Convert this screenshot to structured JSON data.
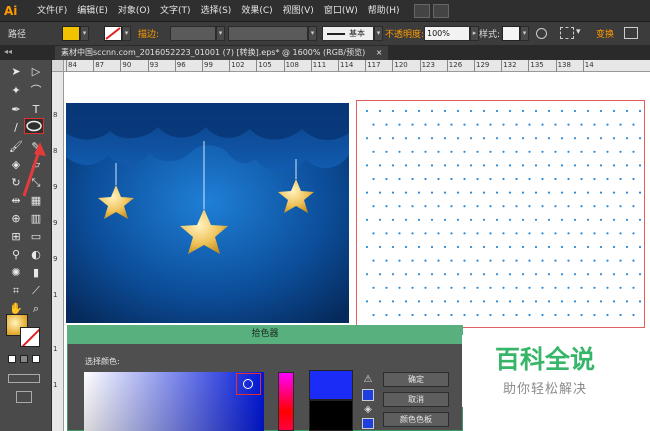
{
  "app": {
    "logo": "Ai"
  },
  "menubar": {
    "items": [
      "文件(F)",
      "编辑(E)",
      "对象(O)",
      "文字(T)",
      "选择(S)",
      "效果(C)",
      "视图(V)",
      "窗口(W)",
      "帮助(H)"
    ]
  },
  "controlbar": {
    "path_label": "路径",
    "stroke_label": "描边:",
    "basic_label": "基本",
    "opacity_label": "不透明度:",
    "opacity_value": "100%",
    "style_label": "样式:",
    "transform_label": "变换",
    "colors": {
      "fill": "#f2c200",
      "warning": "#ff9a00"
    }
  },
  "document": {
    "tab_title": "素材中国sccnn.com_2016052223_01001  (7)  [转换].eps* @ 1600% (RGB/预览)"
  },
  "ruler": {
    "marks": [
      "84",
      "87",
      "90",
      "93",
      "96",
      "99",
      "102",
      "105",
      "108",
      "111",
      "114",
      "117",
      "120",
      "123",
      "126",
      "129",
      "132",
      "135",
      "138",
      "14"
    ]
  },
  "tools": [
    "selection-tool",
    "direct-selection-tool",
    "magic-wand-tool",
    "lasso-tool",
    "pen-tool",
    "type-tool",
    "line-tool",
    "ellipse-tool",
    "paintbrush-tool",
    "pencil-tool",
    "blob-brush-tool",
    "eraser-tool",
    "rotate-tool",
    "scale-tool",
    "width-tool",
    "free-transform-tool",
    "shape-builder-tool",
    "perspective-tool",
    "mesh-tool",
    "gradient-tool",
    "eyedropper-tool",
    "blend-tool",
    "symbol-sprayer-tool",
    "graph-tool",
    "artboard-tool",
    "slice-tool",
    "hand-tool",
    "zoom-tool"
  ],
  "picker": {
    "title": "拾色器",
    "select_label": "选择颜色:",
    "buttons": {
      "ok": "确定",
      "cancel": "取消",
      "swatches": "颜色色板"
    },
    "colors": {
      "new": "#1a2cf5",
      "old": "#000000"
    }
  },
  "watermark": {
    "title": "百科全说",
    "subtitle": "助你轻松解决"
  }
}
